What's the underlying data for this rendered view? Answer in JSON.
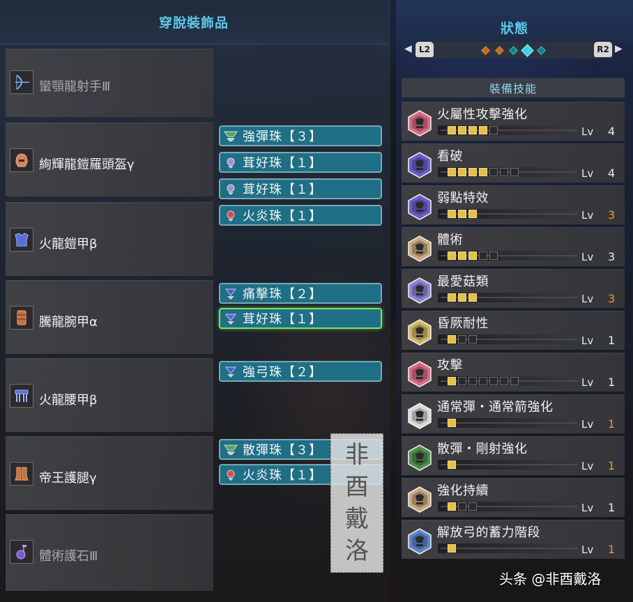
{
  "left_panel": {
    "title": "穿脫裝飾品",
    "equipment": [
      {
        "name": "蠻顎龍射手Ⅲ",
        "icon": "weapon-bow-icon",
        "empty": true,
        "decorations": []
      },
      {
        "name": "絢輝龍鎧羅頭盔γ",
        "icon": "helmet-icon",
        "empty": false,
        "decorations": [
          {
            "label": "強彈珠【３】",
            "icon": "jewel-lv3-icon"
          },
          {
            "label": "茸好珠【１】",
            "icon": "jewel-lv1-icon"
          },
          {
            "label": "茸好珠【１】",
            "icon": "jewel-lv1-icon"
          }
        ]
      },
      {
        "name": "火龍鎧甲β",
        "icon": "chest-armor-icon",
        "empty": false,
        "decorations": [
          {
            "label": "火炎珠【１】",
            "icon": "jewel-lv1-fire-icon"
          }
        ]
      },
      {
        "name": "騰龍腕甲α",
        "icon": "arm-armor-icon",
        "empty": false,
        "decorations": [
          {
            "label": "痛擊珠【２】",
            "icon": "jewel-lv2-icon"
          },
          {
            "label": "茸好珠【１】",
            "icon": "jewel-lv1-icon",
            "selected": true
          }
        ]
      },
      {
        "name": "火龍腰甲β",
        "icon": "waist-armor-icon",
        "empty": false,
        "decorations": [
          {
            "label": "強弓珠【２】",
            "icon": "jewel-lv2-icon"
          }
        ]
      },
      {
        "name": "帝王護腿γ",
        "icon": "leg-armor-icon",
        "empty": false,
        "decorations": [
          {
            "label": "散彈珠【３】",
            "icon": "jewel-lv3-icon"
          },
          {
            "label": "火炎珠【１】",
            "icon": "jewel-lv1-fire-icon"
          }
        ]
      },
      {
        "name": "體術護石Ⅲ",
        "icon": "charm-icon",
        "empty": true,
        "decorations": []
      }
    ]
  },
  "right_panel": {
    "title": "狀態",
    "left_button": "L2",
    "right_button": "R2",
    "pages": 5,
    "active_page": 4,
    "skills_header": "裝備技能",
    "lv_label": "Lv",
    "skills": [
      {
        "name": "火屬性攻擊強化",
        "level": "4",
        "max": 5,
        "maxed": false,
        "gem_color": "#d96a86"
      },
      {
        "name": "看破",
        "level": "4",
        "max": 7,
        "maxed": false,
        "gem_color": "#6a5fc8"
      },
      {
        "name": "弱點特效",
        "level": "3",
        "max": 3,
        "maxed": true,
        "gem_color": "#6a5fc8"
      },
      {
        "name": "體術",
        "level": "3",
        "max": 5,
        "maxed": false,
        "gem_color": "#c8a97e"
      },
      {
        "name": "最愛菇類",
        "level": "3",
        "max": 3,
        "maxed": true,
        "gem_color": "#8c86d8"
      },
      {
        "name": "昏厥耐性",
        "level": "1",
        "max": 3,
        "maxed": false,
        "gem_color": "#d2b464"
      },
      {
        "name": "攻擊",
        "level": "1",
        "max": 7,
        "maxed": false,
        "gem_color": "#d96a86"
      },
      {
        "name": "通常彈・通常箭強化",
        "level": "1",
        "max": 1,
        "maxed": true,
        "gem_color": "#d8d8d8"
      },
      {
        "name": "散彈・剛射強化",
        "level": "1",
        "max": 1,
        "maxed": true,
        "gem_color": "#4f8f4a"
      },
      {
        "name": "強化持續",
        "level": "1",
        "max": 3,
        "maxed": false,
        "gem_color": "#c8a97e"
      },
      {
        "name": "解放弓的蓄力階段",
        "level": "1",
        "max": 1,
        "maxed": true,
        "gem_color": "#5b86c8"
      }
    ]
  },
  "watermark": [
    "非",
    "酉",
    "戴",
    "洛"
  ],
  "credit": "头条 @非酉戴洛"
}
